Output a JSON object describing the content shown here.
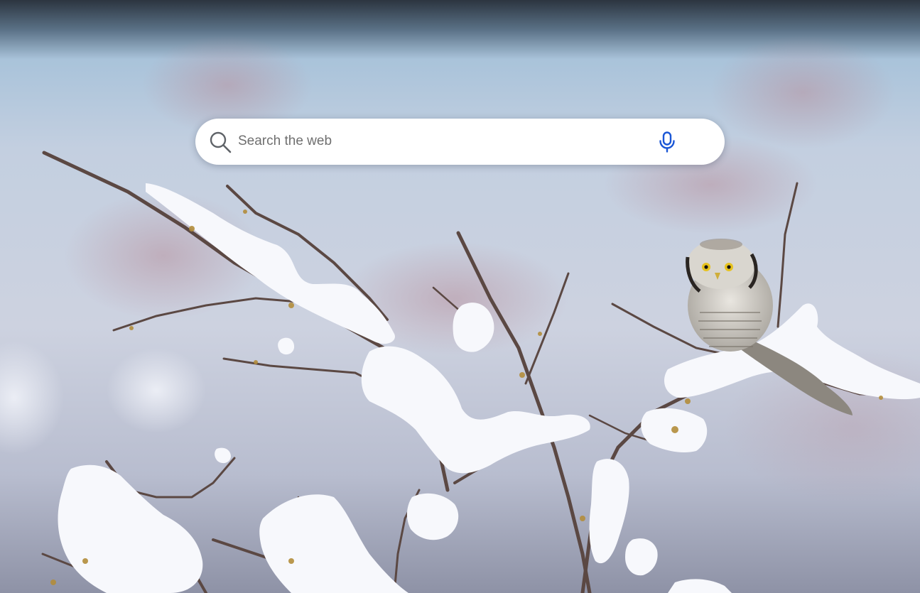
{
  "search": {
    "placeholder": "Search the web",
    "value": ""
  },
  "icons": {
    "search": "search-icon",
    "voice": "microphone-icon"
  },
  "colors": {
    "search_icon": "#5f6368",
    "mic_accent": "#1a56d6",
    "search_box": "#ffffff"
  },
  "background": {
    "subject": "snow-covered-branches-with-owl"
  }
}
